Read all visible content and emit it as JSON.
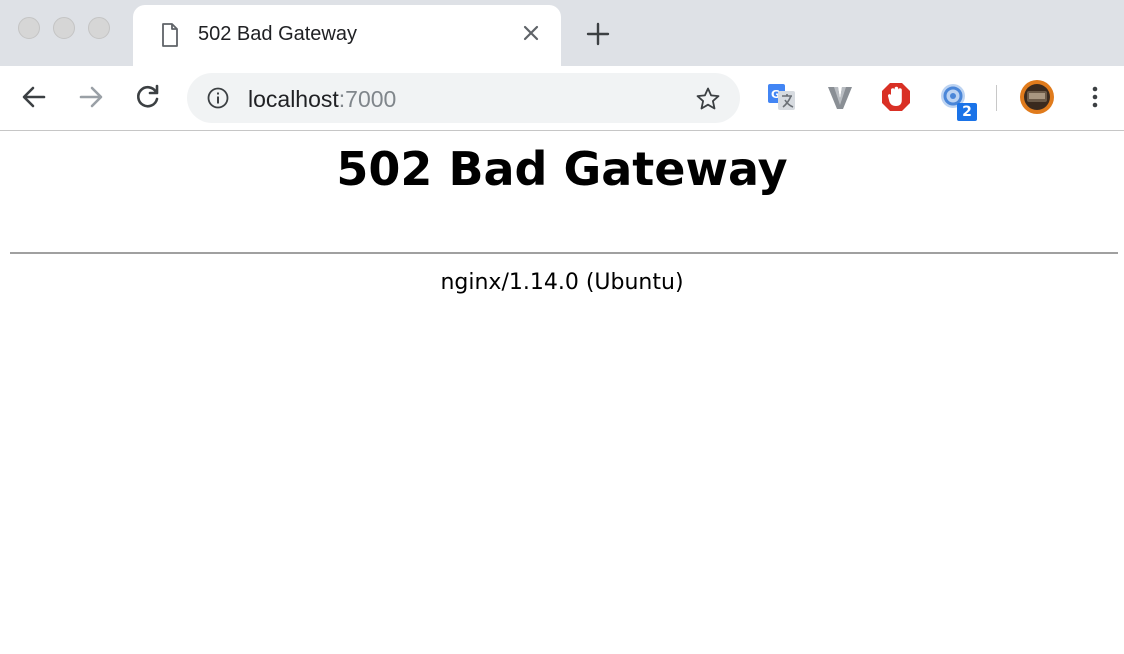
{
  "browser": {
    "tab": {
      "title": "502 Bad Gateway",
      "icon": "document-icon"
    },
    "address_bar": {
      "host": "localhost",
      "port": ":7000"
    },
    "extensions": [
      {
        "name": "google-translate-icon"
      },
      {
        "name": "vimium-icon"
      },
      {
        "name": "opera-adblock-icon"
      },
      {
        "name": "extension-badge-icon",
        "badge": "2"
      },
      {
        "name": "profile-avatar"
      }
    ]
  },
  "page": {
    "heading": "502 Bad Gateway",
    "footer": "nginx/1.14.0 (Ubuntu)"
  }
}
